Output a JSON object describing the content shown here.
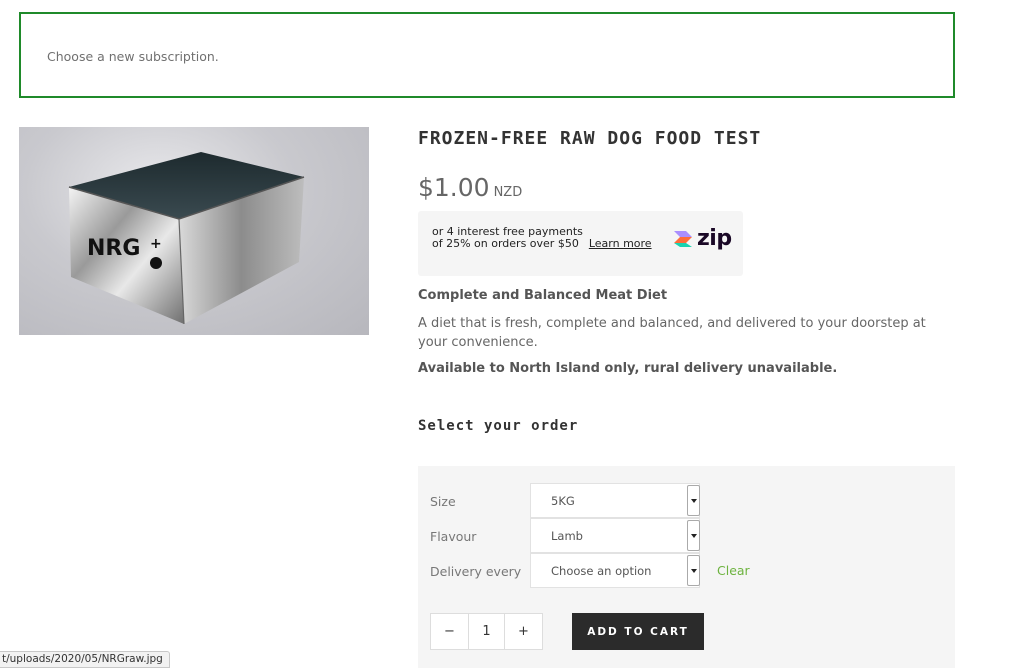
{
  "notice": {
    "text": "Choose a new subscription."
  },
  "product": {
    "image_alt": "NRG box",
    "image_brand_text": "NRG",
    "title": "FROZEN-FREE RAW DOG FOOD TEST",
    "price": "$1.00",
    "currency": "NZD"
  },
  "zip": {
    "line1": "or 4 interest free payments",
    "line2": "of 25% on orders over $50",
    "learn_more": "Learn more",
    "logo_text": "zip"
  },
  "description": {
    "heading": "Complete and Balanced Meat Diet",
    "body": "A diet that is fresh, complete and balanced, and delivered to your doorstep at your convenience.",
    "availability": "Available to North Island only, rural delivery unavailable."
  },
  "order": {
    "title": "Select your order",
    "options": [
      {
        "label": "Size",
        "value": "5KG"
      },
      {
        "label": "Flavour",
        "value": "Lamb"
      },
      {
        "label": "Delivery every",
        "value": "Choose an option"
      }
    ],
    "clear_label": "Clear",
    "quantity": {
      "minus": "−",
      "value": "1",
      "plus": "+"
    },
    "add_to_cart": "ADD TO CART"
  },
  "status_bar": {
    "url": "t/uploads/2020/05/NRGraw.jpg"
  },
  "colors": {
    "notice_border": "#1f8a2a",
    "clear_link": "#6db33f",
    "button_bg": "#2b2b2b"
  }
}
